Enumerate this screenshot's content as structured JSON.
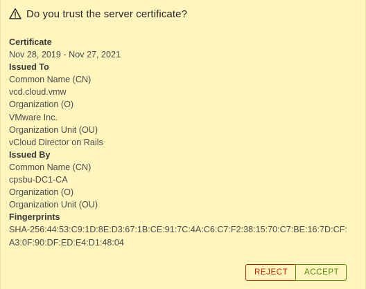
{
  "dialog": {
    "title": "Do you trust the server certificate?",
    "icon": "warning-triangle-icon"
  },
  "certificate": {
    "lines": [
      {
        "text": "Certificate",
        "style": "bold"
      },
      {
        "text": "Nov 28, 2019 - Nov 27, 2021",
        "style": "value"
      },
      {
        "text": "Issued To",
        "style": "bold"
      },
      {
        "text": "Common Name (CN)",
        "style": "value"
      },
      {
        "text": "vcd.cloud.vmw",
        "style": "value"
      },
      {
        "text": "Organization (O)",
        "style": "value"
      },
      {
        "text": "VMware Inc.",
        "style": "value"
      },
      {
        "text": "Organization Unit (OU)",
        "style": "value"
      },
      {
        "text": "vCloud Director on Rails",
        "style": "value"
      },
      {
        "text": "Issued By",
        "style": "bold"
      },
      {
        "text": "Common Name (CN)",
        "style": "value"
      },
      {
        "text": "cpsbu-DC1-CA",
        "style": "value"
      },
      {
        "text": "Organization (O)",
        "style": "value"
      },
      {
        "text": "Organization Unit (OU)",
        "style": "value"
      },
      {
        "text": "Fingerprints",
        "style": "bold"
      },
      {
        "text": "SHA-256:44:53:C9:1D:8E:D3:67:1B:CE:91:7C:4A:C6:C7:F2:38:15:70:C7:BE:16:7D:CF:",
        "style": "value"
      },
      {
        "text": "A3:0F:90:DF:ED:E4:D1:48:04",
        "style": "value"
      }
    ]
  },
  "buttons": {
    "reject_label": "REJECT",
    "accept_label": "ACCEPT"
  },
  "colors": {
    "background": "#fff5bd",
    "reject": "#c92100",
    "accept": "#4c8a00"
  }
}
